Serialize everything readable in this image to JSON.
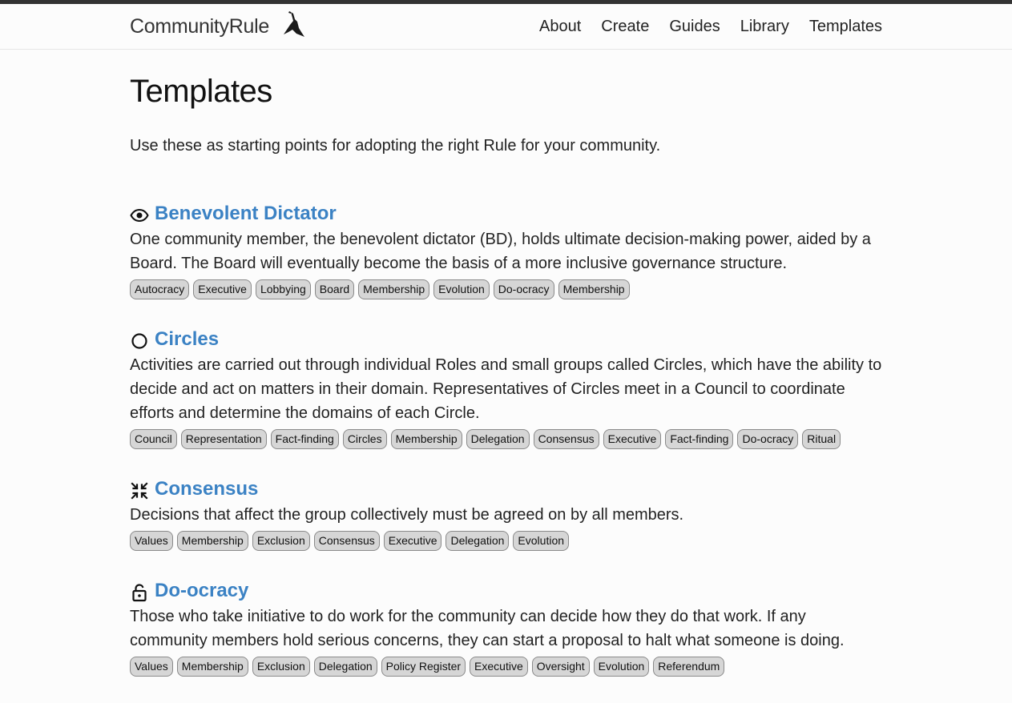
{
  "header": {
    "brand": "CommunityRule",
    "logo_icon": "bird-icon",
    "nav": [
      "About",
      "Create",
      "Guides",
      "Library",
      "Templates"
    ]
  },
  "page": {
    "title": "Templates",
    "intro": "Use these as starting points for adopting the right Rule for your community."
  },
  "templates": [
    {
      "icon": "eye-icon",
      "title": "Benevolent Dictator",
      "description": "One community member, the benevolent dictator (BD), holds ultimate decision-making power, aided by a Board. The Board will eventually become the basis of a more inclusive governance structure.",
      "tags": [
        "Autocracy",
        "Executive",
        "Lobbying",
        "Board",
        "Membership",
        "Evolution",
        "Do-ocracy",
        "Membership"
      ]
    },
    {
      "icon": "circle-icon",
      "title": "Circles",
      "description": "Activities are carried out through individual Roles and small groups called Circles, which have the ability to decide and act on matters in their domain. Representatives of Circles meet in a Council to coordinate efforts and determine the domains of each Circle.",
      "tags": [
        "Council",
        "Representation",
        "Fact-finding",
        "Circles",
        "Membership",
        "Delegation",
        "Consensus",
        "Executive",
        "Fact-finding",
        "Do-ocracy",
        "Ritual"
      ]
    },
    {
      "icon": "converge-icon",
      "title": "Consensus",
      "description": "Decisions that affect the group collectively must be agreed on by all members.",
      "tags": [
        "Values",
        "Membership",
        "Exclusion",
        "Consensus",
        "Executive",
        "Delegation",
        "Evolution"
      ]
    },
    {
      "icon": "unlocked-icon",
      "title": "Do-ocracy",
      "description": "Those who take initiative to do work for the community can decide how they do that work. If any community members hold serious concerns, they can start a proposal to halt what someone is doing.",
      "tags": [
        "Values",
        "Membership",
        "Exclusion",
        "Delegation",
        "Policy Register",
        "Executive",
        "Oversight",
        "Evolution",
        "Referendum"
      ]
    }
  ]
}
